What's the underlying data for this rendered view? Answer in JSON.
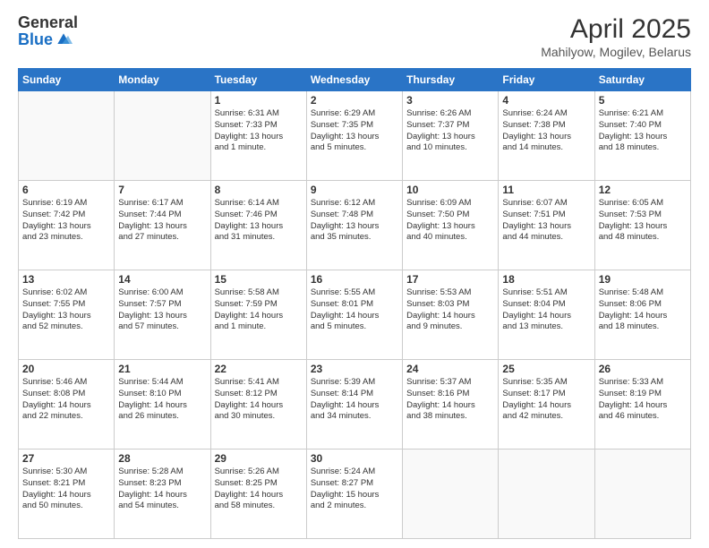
{
  "logo": {
    "general": "General",
    "blue": "Blue"
  },
  "header": {
    "title": "April 2025",
    "location": "Mahilyow, Mogilev, Belarus"
  },
  "weekdays": [
    "Sunday",
    "Monday",
    "Tuesday",
    "Wednesday",
    "Thursday",
    "Friday",
    "Saturday"
  ],
  "weeks": [
    [
      {
        "day": "",
        "info": ""
      },
      {
        "day": "",
        "info": ""
      },
      {
        "day": "1",
        "info": "Sunrise: 6:31 AM\nSunset: 7:33 PM\nDaylight: 13 hours\nand 1 minute."
      },
      {
        "day": "2",
        "info": "Sunrise: 6:29 AM\nSunset: 7:35 PM\nDaylight: 13 hours\nand 5 minutes."
      },
      {
        "day": "3",
        "info": "Sunrise: 6:26 AM\nSunset: 7:37 PM\nDaylight: 13 hours\nand 10 minutes."
      },
      {
        "day": "4",
        "info": "Sunrise: 6:24 AM\nSunset: 7:38 PM\nDaylight: 13 hours\nand 14 minutes."
      },
      {
        "day": "5",
        "info": "Sunrise: 6:21 AM\nSunset: 7:40 PM\nDaylight: 13 hours\nand 18 minutes."
      }
    ],
    [
      {
        "day": "6",
        "info": "Sunrise: 6:19 AM\nSunset: 7:42 PM\nDaylight: 13 hours\nand 23 minutes."
      },
      {
        "day": "7",
        "info": "Sunrise: 6:17 AM\nSunset: 7:44 PM\nDaylight: 13 hours\nand 27 minutes."
      },
      {
        "day": "8",
        "info": "Sunrise: 6:14 AM\nSunset: 7:46 PM\nDaylight: 13 hours\nand 31 minutes."
      },
      {
        "day": "9",
        "info": "Sunrise: 6:12 AM\nSunset: 7:48 PM\nDaylight: 13 hours\nand 35 minutes."
      },
      {
        "day": "10",
        "info": "Sunrise: 6:09 AM\nSunset: 7:50 PM\nDaylight: 13 hours\nand 40 minutes."
      },
      {
        "day": "11",
        "info": "Sunrise: 6:07 AM\nSunset: 7:51 PM\nDaylight: 13 hours\nand 44 minutes."
      },
      {
        "day": "12",
        "info": "Sunrise: 6:05 AM\nSunset: 7:53 PM\nDaylight: 13 hours\nand 48 minutes."
      }
    ],
    [
      {
        "day": "13",
        "info": "Sunrise: 6:02 AM\nSunset: 7:55 PM\nDaylight: 13 hours\nand 52 minutes."
      },
      {
        "day": "14",
        "info": "Sunrise: 6:00 AM\nSunset: 7:57 PM\nDaylight: 13 hours\nand 57 minutes."
      },
      {
        "day": "15",
        "info": "Sunrise: 5:58 AM\nSunset: 7:59 PM\nDaylight: 14 hours\nand 1 minute."
      },
      {
        "day": "16",
        "info": "Sunrise: 5:55 AM\nSunset: 8:01 PM\nDaylight: 14 hours\nand 5 minutes."
      },
      {
        "day": "17",
        "info": "Sunrise: 5:53 AM\nSunset: 8:03 PM\nDaylight: 14 hours\nand 9 minutes."
      },
      {
        "day": "18",
        "info": "Sunrise: 5:51 AM\nSunset: 8:04 PM\nDaylight: 14 hours\nand 13 minutes."
      },
      {
        "day": "19",
        "info": "Sunrise: 5:48 AM\nSunset: 8:06 PM\nDaylight: 14 hours\nand 18 minutes."
      }
    ],
    [
      {
        "day": "20",
        "info": "Sunrise: 5:46 AM\nSunset: 8:08 PM\nDaylight: 14 hours\nand 22 minutes."
      },
      {
        "day": "21",
        "info": "Sunrise: 5:44 AM\nSunset: 8:10 PM\nDaylight: 14 hours\nand 26 minutes."
      },
      {
        "day": "22",
        "info": "Sunrise: 5:41 AM\nSunset: 8:12 PM\nDaylight: 14 hours\nand 30 minutes."
      },
      {
        "day": "23",
        "info": "Sunrise: 5:39 AM\nSunset: 8:14 PM\nDaylight: 14 hours\nand 34 minutes."
      },
      {
        "day": "24",
        "info": "Sunrise: 5:37 AM\nSunset: 8:16 PM\nDaylight: 14 hours\nand 38 minutes."
      },
      {
        "day": "25",
        "info": "Sunrise: 5:35 AM\nSunset: 8:17 PM\nDaylight: 14 hours\nand 42 minutes."
      },
      {
        "day": "26",
        "info": "Sunrise: 5:33 AM\nSunset: 8:19 PM\nDaylight: 14 hours\nand 46 minutes."
      }
    ],
    [
      {
        "day": "27",
        "info": "Sunrise: 5:30 AM\nSunset: 8:21 PM\nDaylight: 14 hours\nand 50 minutes."
      },
      {
        "day": "28",
        "info": "Sunrise: 5:28 AM\nSunset: 8:23 PM\nDaylight: 14 hours\nand 54 minutes."
      },
      {
        "day": "29",
        "info": "Sunrise: 5:26 AM\nSunset: 8:25 PM\nDaylight: 14 hours\nand 58 minutes."
      },
      {
        "day": "30",
        "info": "Sunrise: 5:24 AM\nSunset: 8:27 PM\nDaylight: 15 hours\nand 2 minutes."
      },
      {
        "day": "",
        "info": ""
      },
      {
        "day": "",
        "info": ""
      },
      {
        "day": "",
        "info": ""
      }
    ]
  ]
}
